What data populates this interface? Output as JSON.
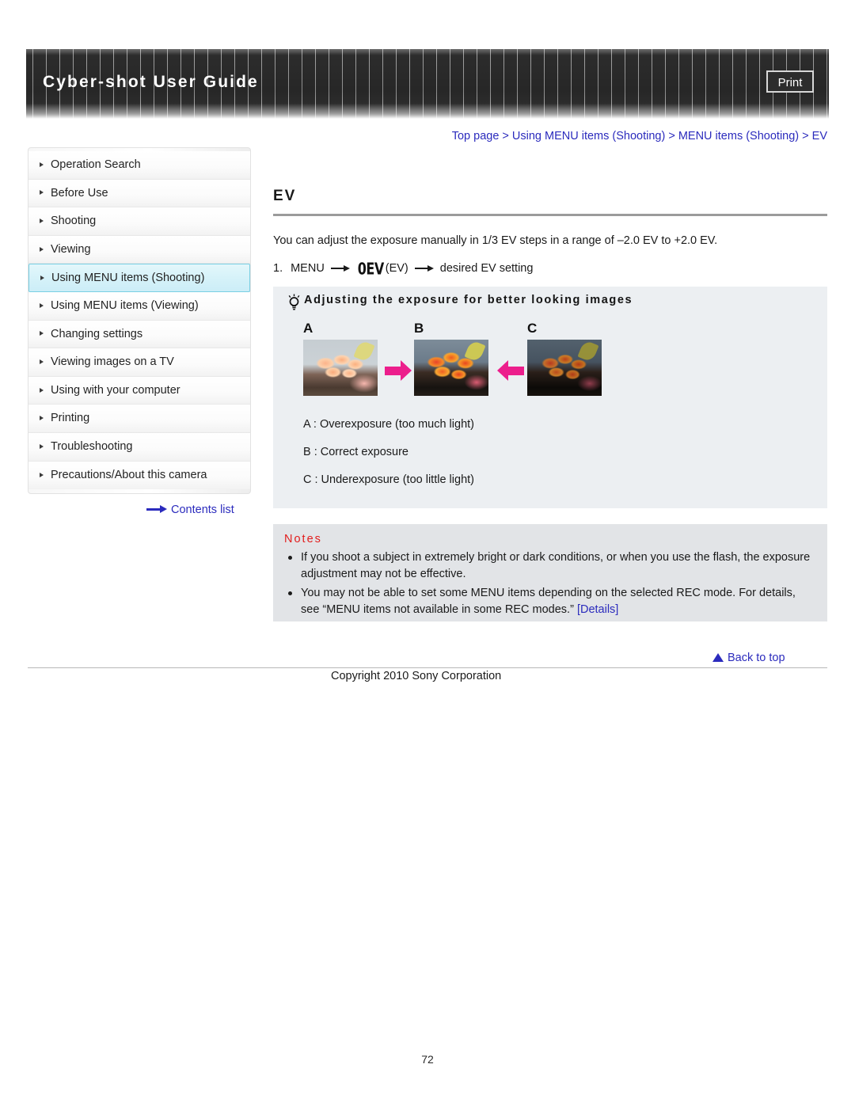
{
  "header": {
    "title": "Cyber-shot User Guide",
    "print_label": "Print"
  },
  "breadcrumb": {
    "text": "Top page > Using MENU items (Shooting) > MENU items (Shooting) > EV"
  },
  "sidebar": {
    "items": [
      {
        "label": "Operation Search",
        "active": false
      },
      {
        "label": "Before Use",
        "active": false
      },
      {
        "label": "Shooting",
        "active": false
      },
      {
        "label": "Viewing",
        "active": false
      },
      {
        "label": "Using MENU items (Shooting)",
        "active": true
      },
      {
        "label": "Using MENU items (Viewing)",
        "active": false
      },
      {
        "label": "Changing settings",
        "active": false
      },
      {
        "label": "Viewing images on a TV",
        "active": false
      },
      {
        "label": "Using with your computer",
        "active": false
      },
      {
        "label": "Printing",
        "active": false
      },
      {
        "label": "Troubleshooting",
        "active": false
      },
      {
        "label": "Precautions/About this camera",
        "active": false
      }
    ],
    "contents_list_label": "Contents list"
  },
  "main": {
    "title": "EV",
    "intro": "You can adjust the exposure manually in 1/3 EV steps in a range of –2.0 EV to +2.0 EV.",
    "step": {
      "number": "1.",
      "part1": "MENU",
      "icon_glyph": "0EV",
      "part2": "(EV)",
      "part3": "desired EV setting"
    }
  },
  "tip": {
    "heading": "Adjusting the exposure for better looking images",
    "photos": [
      {
        "label": "A"
      },
      {
        "label": "B"
      },
      {
        "label": "C"
      }
    ],
    "captions": [
      "A : Overexposure (too much light)",
      "B : Correct exposure",
      "C : Underexposure (too little light)"
    ]
  },
  "notes": {
    "title": "Notes",
    "items": [
      {
        "text": "If you shoot a subject in extremely bright or dark conditions, or when you use the flash, the exposure adjustment may not be effective.",
        "link": ""
      },
      {
        "text": "You may not be able to set some MENU items depending on the selected REC mode. For details, see “MENU items not available in some REC modes.” ",
        "link": "[Details]"
      }
    ]
  },
  "footer": {
    "back_to_top": "Back to top",
    "copyright": "Copyright 2010 Sony Corporation",
    "page_number": "72"
  },
  "colors": {
    "link": "#2b2bbd",
    "notes_title": "#e21d1d",
    "highlight_bg": "#d6f2f9",
    "arrow_pink": "#ec1e8c",
    "header_bg": "#2c2c2c"
  }
}
